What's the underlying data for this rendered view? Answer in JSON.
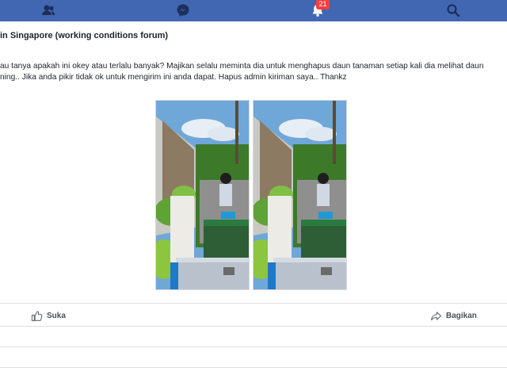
{
  "topbar": {
    "bg_color": "#4267b2",
    "icons": [
      "friends-icon",
      "messenger-icon",
      "notifications-icon",
      "search-icon"
    ],
    "notification_count": "21"
  },
  "post": {
    "group_title": "in Singapore (working conditions forum)",
    "body_line_1": "au tanya apakah ini okey atau terlalu banyak? Majikan selalu meminta dia untuk menghapus daun tanaman setiap kali dia melihat daun",
    "body_line_2": "ning.. Jika anda pikir tidak ok untuk mengirim ini anda dapat. Hapus admin kiriman saya.. Thankz",
    "photos": [
      "photo-left",
      "photo-right"
    ]
  },
  "actions": {
    "like_label": "Suka",
    "share_label": "Bagikan"
  }
}
